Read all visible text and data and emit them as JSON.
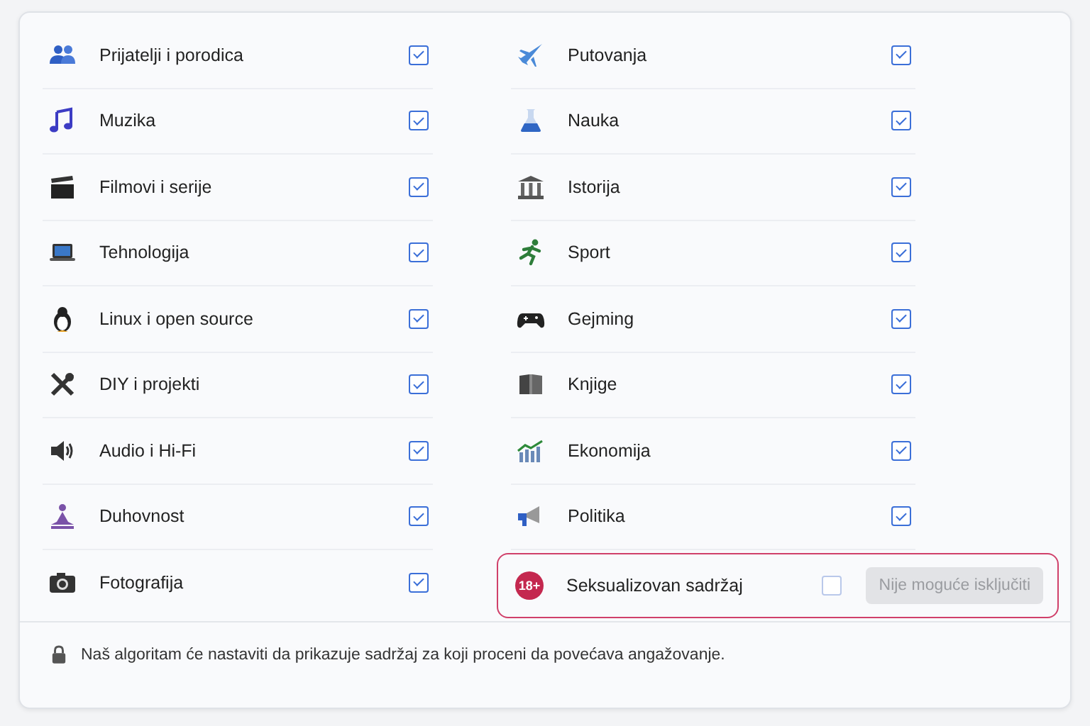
{
  "columns": [
    {
      "items": [
        {
          "label": "Prijatelji i porodica",
          "checked": true
        },
        {
          "label": "Muzika",
          "checked": true
        },
        {
          "label": "Filmovi i serije",
          "checked": true
        },
        {
          "label": "Tehnologija",
          "checked": true
        },
        {
          "label": "Linux i open source",
          "checked": true
        },
        {
          "label": "DIY i projekti",
          "checked": true
        },
        {
          "label": "Audio i Hi-Fi",
          "checked": true
        },
        {
          "label": "Duhovnost",
          "checked": true
        },
        {
          "label": "Fotografija",
          "checked": true
        }
      ]
    },
    {
      "items": [
        {
          "label": "Putovanja",
          "checked": true
        },
        {
          "label": "Nauka",
          "checked": true
        },
        {
          "label": "Istorija",
          "checked": true
        },
        {
          "label": "Sport",
          "checked": true
        },
        {
          "label": "Gejming",
          "checked": true
        },
        {
          "label": "Knjige",
          "checked": true
        },
        {
          "label": "Ekonomija",
          "checked": true
        },
        {
          "label": "Politika",
          "checked": true
        },
        {
          "label": "Seksualizovan sadržaj",
          "checked": false,
          "kind": "locked",
          "badge": "18+",
          "button": {
            "label": "Nije moguće isključiti",
            "disabled": true
          }
        }
      ]
    }
  ],
  "footer": {
    "text": "Naš algoritam će nastaviti da prikazuje sadržaj za koji proceni da povećava angažovanje."
  }
}
